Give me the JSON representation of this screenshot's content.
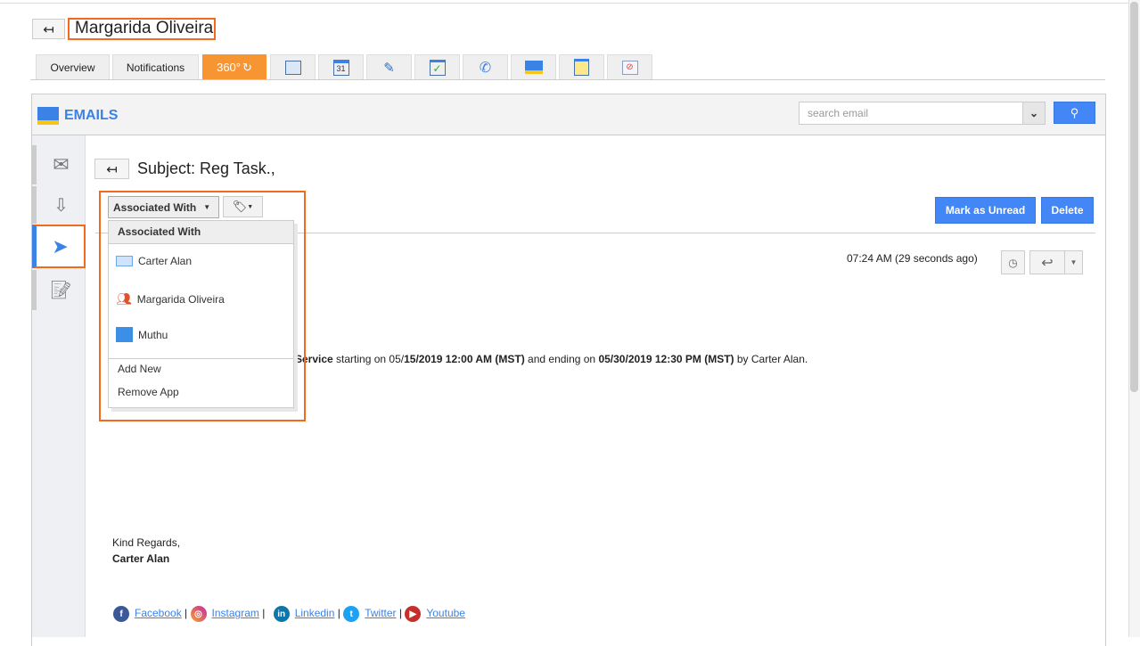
{
  "header": {
    "back_icon": "back-arrow-icon",
    "title": "Margarida Oliveira"
  },
  "tabs": [
    {
      "label": "Overview"
    },
    {
      "label": "Notifications"
    },
    {
      "label": "360°"
    },
    {
      "icon": "contact-card-icon"
    },
    {
      "icon": "calendar-icon",
      "label": "31"
    },
    {
      "icon": "pin-icon"
    },
    {
      "icon": "task-check-icon"
    },
    {
      "icon": "phone-call-icon"
    },
    {
      "icon": "email-icon"
    },
    {
      "icon": "notes-icon"
    },
    {
      "icon": "attachment-icon"
    }
  ],
  "emails": {
    "title": "EMAILS",
    "search_placeholder": "search email"
  },
  "sidebar": [
    {
      "icon": "inbox-envelope-icon"
    },
    {
      "icon": "download-tray-icon"
    },
    {
      "icon": "sent-paper-plane-icon",
      "active": true
    },
    {
      "icon": "draft-edit-icon"
    }
  ],
  "message": {
    "subject": "Subject: Reg Task.,",
    "associated_label": "Associated With",
    "dropdown": {
      "header": "Associated With",
      "items": [
        {
          "label": "Carter Alan",
          "icon": "contact-card-icon"
        },
        {
          "label": "Margarida Oliveira",
          "icon": "people-icon"
        },
        {
          "label": "Muthu",
          "icon": "building-icon"
        }
      ],
      "actions": [
        "Add New",
        "Remove App"
      ]
    },
    "mark_unread": "Mark as Unread",
    "delete": "Delete",
    "time": "07:24 AM (29 seconds ago)",
    "body": {
      "b1": "Service",
      "t1": " starting on 05/",
      "b2": "15/2019 12:00 AM (MST)",
      "t2": " and ending on ",
      "b3": "05/30/2019 12:30 PM (MST)",
      "t3": " by Carter Alan."
    },
    "closing": "Kind Regards,",
    "signature": "Carter Alan",
    "social": [
      "Facebook",
      "Instagram",
      "Linkedin",
      "Twitter",
      "Youtube"
    ],
    "separator": "|"
  },
  "colors": {
    "accent": "#4287f5",
    "highlight": "#f26b1d",
    "tab_active": "#f79533"
  }
}
